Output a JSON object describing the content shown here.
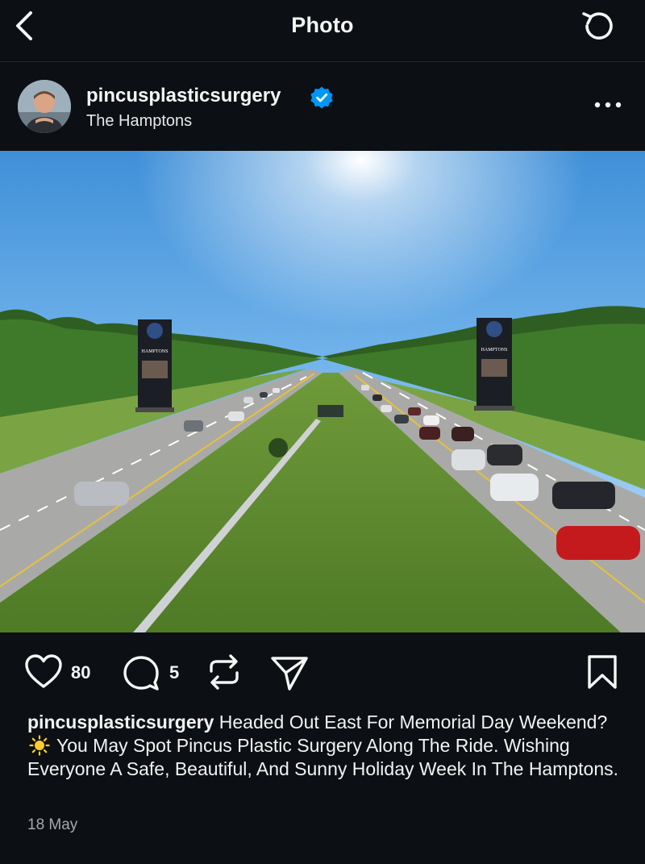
{
  "header": {
    "title": "Photo",
    "back_icon": "chevron-left-icon",
    "refresh_icon": "refresh-icon"
  },
  "post": {
    "username": "pincusplasticsurgery",
    "verified": true,
    "location": "The Hamptons",
    "more_icon": "more-horizontal-icon",
    "image_alt": "Aerial view of a highway with traffic heading east, flanked by two Pincus Plastic Surgery billboards"
  },
  "photo_signs": {
    "left_text": "HAMPTONS",
    "right_text": "HAMPTONS"
  },
  "actions": {
    "likes": "80",
    "comments": "5",
    "like_icon": "heart-icon",
    "comment_icon": "comment-icon",
    "repost_icon": "repost-icon",
    "share_icon": "send-icon",
    "save_icon": "bookmark-icon"
  },
  "caption": {
    "username": "pincusplasticsurgery",
    "text_before_emoji": "Headed Out East For Memorial Day Weekend?",
    "emoji": "sun-icon",
    "text_after_emoji": "You May Spot Pincus Plastic Surgery Along The Ride. Wishing Everyone A Safe, Beautiful, And Sunny Holiday Week In The Hamptons."
  },
  "date": "18 May",
  "colors": {
    "background": "#0c1014",
    "text": "#f5f5f5",
    "secondary_text": "#a8a8a8",
    "verified_blue": "#0095f6"
  }
}
